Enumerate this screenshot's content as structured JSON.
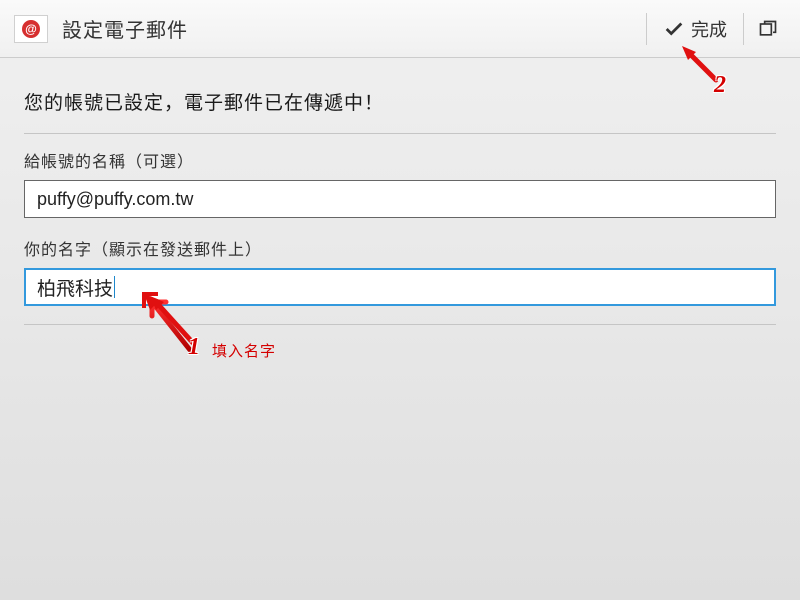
{
  "header": {
    "title": "設定電子郵件",
    "done_label": "完成"
  },
  "main": {
    "heading": "您的帳號已設定，電子郵件已在傳遞中！",
    "account_name_label": "給帳號的名稱（可選）",
    "account_name_value": "puffy@puffy.com.tw",
    "your_name_label": "你的名字（顯示在發送郵件上）",
    "your_name_value": "柏飛科技"
  },
  "annotations": {
    "step1_number": "1",
    "step1_text": "填入名字",
    "step2_number": "2"
  }
}
